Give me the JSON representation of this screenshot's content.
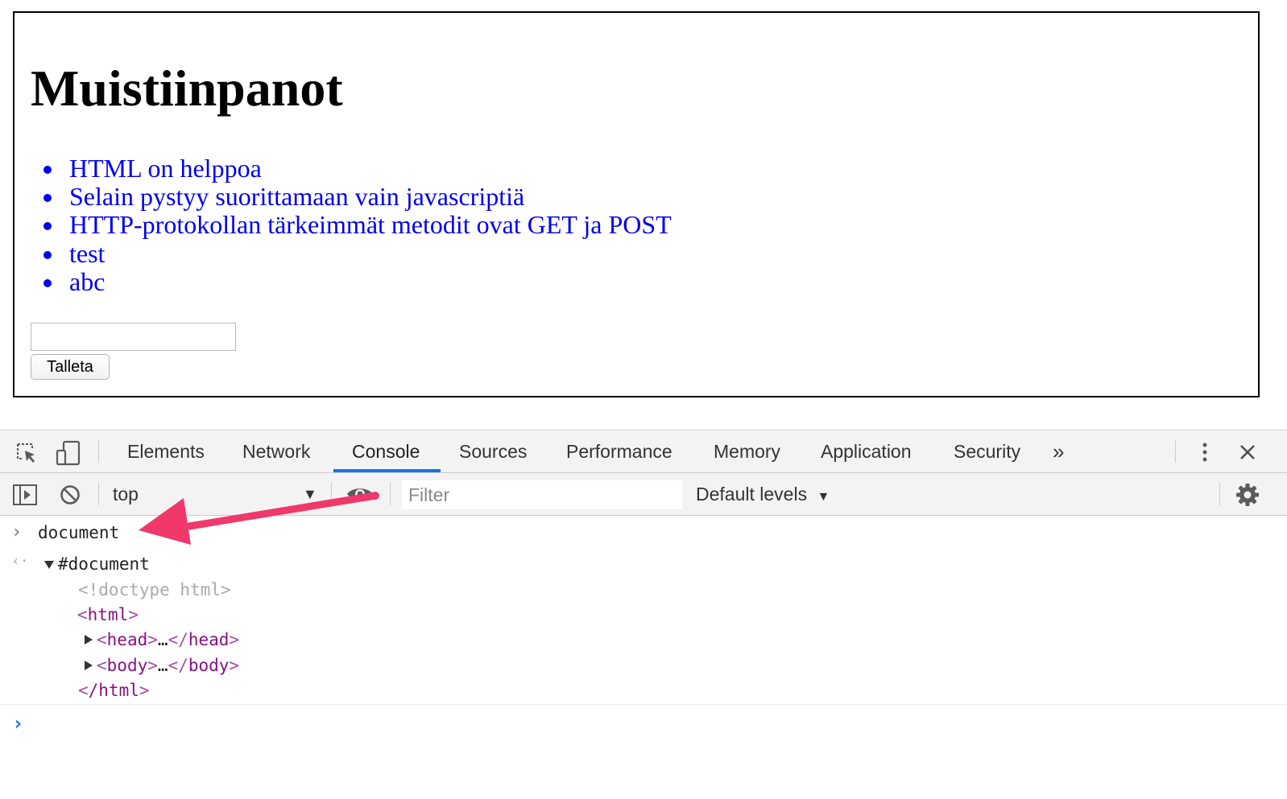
{
  "page": {
    "title": "Muistiinpanot",
    "notes": [
      "HTML on helppoa",
      "Selain pystyy suorittamaan vain javascriptiä",
      "HTTP-protokollan tärkeimmät metodit ovat GET ja POST",
      "test",
      "abc"
    ],
    "input_value": "",
    "save_label": "Talleta"
  },
  "devtools": {
    "tabs": [
      "Elements",
      "Network",
      "Console",
      "Sources",
      "Performance",
      "Memory",
      "Application",
      "Security"
    ],
    "active_tab": "Console",
    "overflow": "»",
    "context": "top",
    "filter_placeholder": "Filter",
    "levels_label": "Default levels",
    "levels_arrow": "▼",
    "select_arrow": "▼",
    "icons": {
      "inspect": "inspect-element-icon",
      "device": "device-toolbar-icon",
      "more": "more-vertical-icon",
      "close": "close-icon",
      "sidebar": "show-sidebar-icon",
      "clear": "clear-console-icon",
      "eye": "live-expression-icon",
      "settings": "gear-icon"
    }
  },
  "console": {
    "input_prompt": "›",
    "result_prompt": "‹·",
    "command": "document",
    "result": {
      "root": "#document",
      "doctype": "<!doctype html>",
      "html_open_tag": "html",
      "head_tag": "head",
      "body_tag": "body",
      "html_close_tag": "/html",
      "ellipsis": "…"
    },
    "cursor_prompt": "›"
  },
  "colors": {
    "link": "#0000ee",
    "active_tab_underline": "#1a73e8",
    "annotation_arrow": "#f0386b",
    "tag": "#881280"
  }
}
